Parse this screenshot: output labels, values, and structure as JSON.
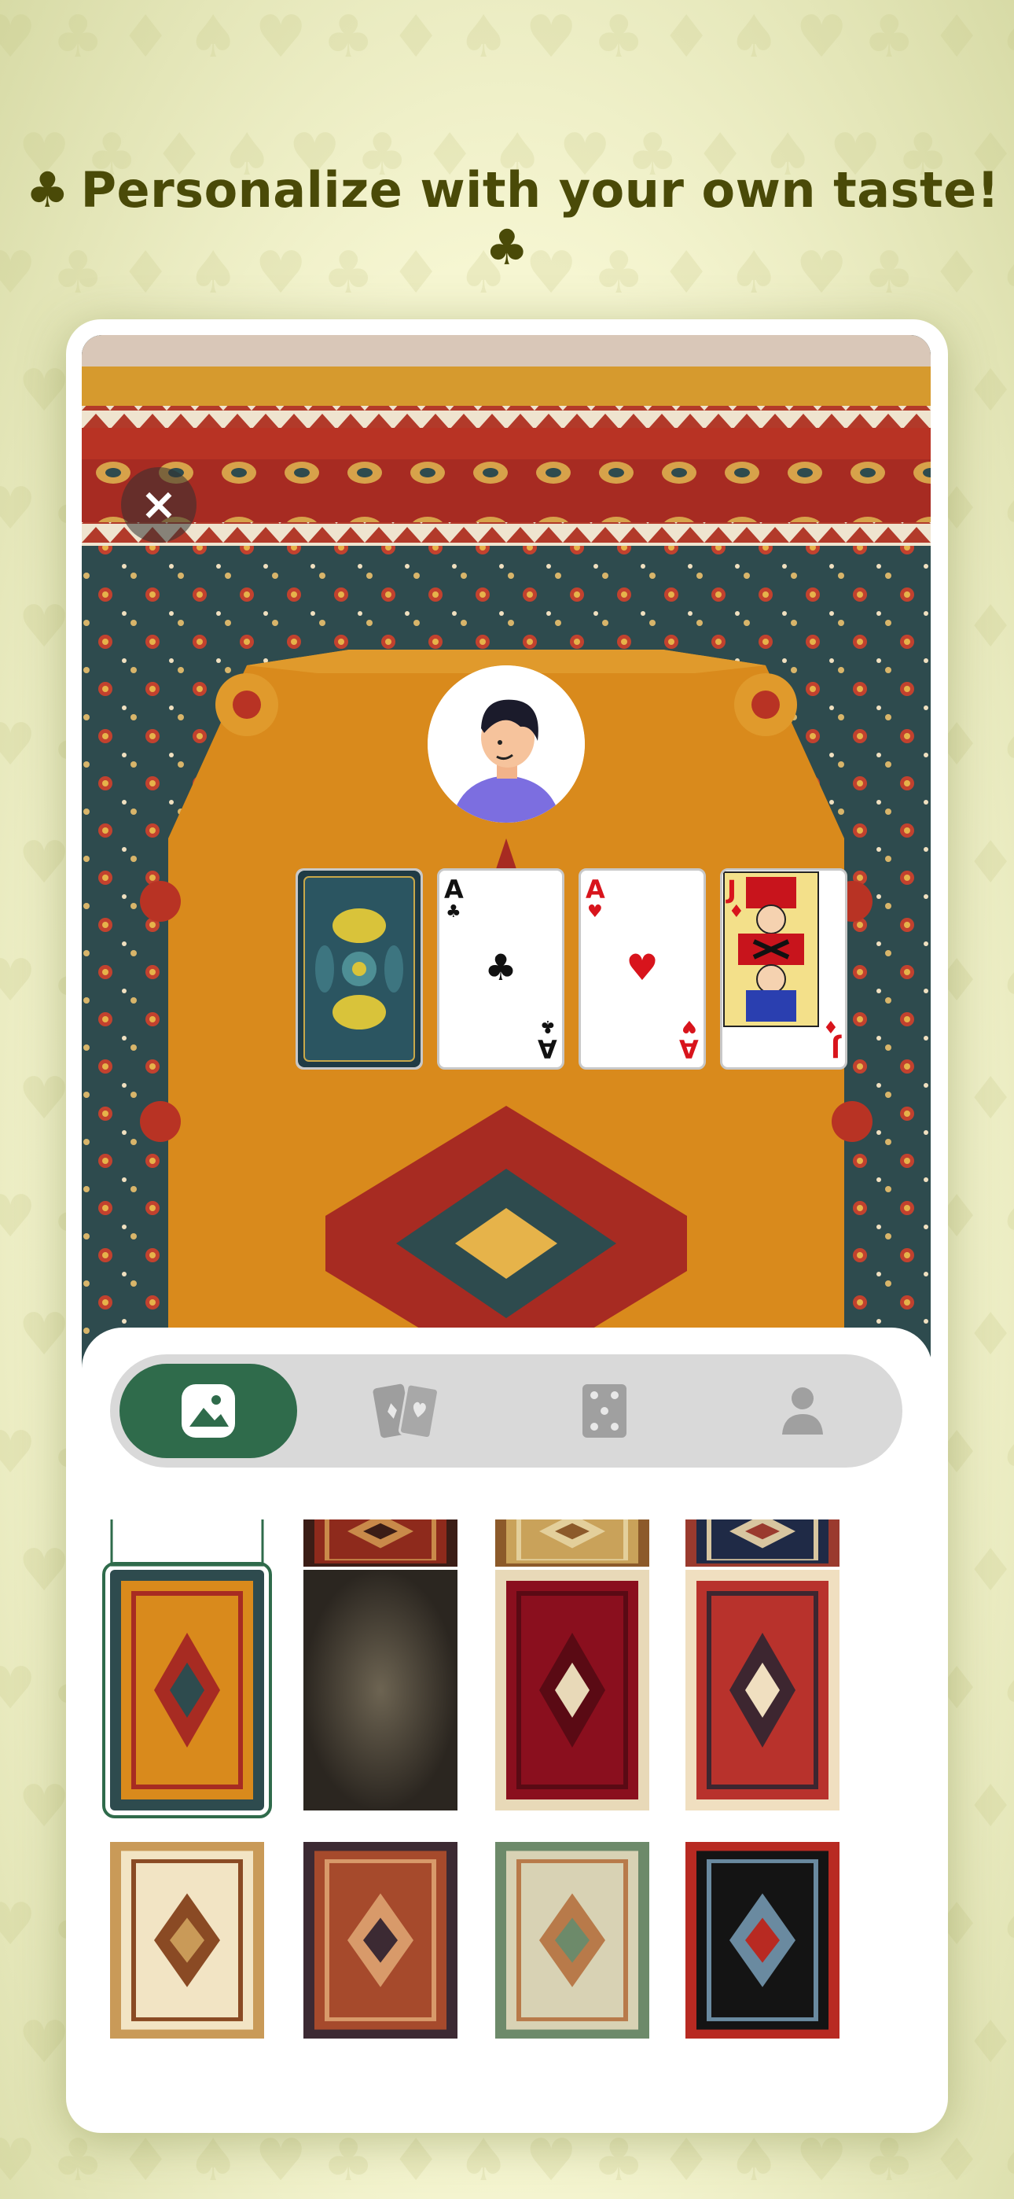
{
  "headline": {
    "text": "Personalize with your own taste!",
    "left_icon": "club-icon",
    "right_icon": "club-icon"
  },
  "table": {
    "close_icon": "close-icon",
    "avatar": "player-avatar",
    "cards": [
      {
        "kind": "back",
        "name": "card-back"
      },
      {
        "rank": "A",
        "suit": "♣",
        "color": "black"
      },
      {
        "rank": "A",
        "suit": "♥",
        "color": "red"
      },
      {
        "rank": "J",
        "suit": "♦",
        "color": "red"
      }
    ]
  },
  "tabs": [
    {
      "name": "background-tab",
      "icon": "image-icon",
      "active": true
    },
    {
      "name": "card-deck-tab",
      "icon": "cards-icon",
      "active": false
    },
    {
      "name": "card-face-tab",
      "icon": "dice-card-icon",
      "active": false
    },
    {
      "name": "avatar-tab",
      "icon": "person-icon",
      "active": false
    }
  ],
  "backgrounds": [
    {
      "id": "plain-white",
      "selected": false
    },
    {
      "id": "red-rug-1",
      "selected": false
    },
    {
      "id": "gold-rug-1",
      "selected": false
    },
    {
      "id": "navy-rug-1",
      "selected": false
    },
    {
      "id": "orange-medallion-rug",
      "selected": true
    },
    {
      "id": "dark-damask",
      "selected": false
    },
    {
      "id": "crimson-border-rug",
      "selected": false
    },
    {
      "id": "red-medallion-rug",
      "selected": false
    },
    {
      "id": "cream-medallion-rug",
      "selected": false
    },
    {
      "id": "terracotta-rug",
      "selected": false
    },
    {
      "id": "pictorial-garden-rug",
      "selected": false
    },
    {
      "id": "black-red-geometric-rug",
      "selected": false
    }
  ],
  "colors": {
    "accent": "#2f6b4b",
    "headline": "#4a4a08",
    "page_background": "#f6f6d2",
    "tab_track": "#d9d9d9"
  }
}
